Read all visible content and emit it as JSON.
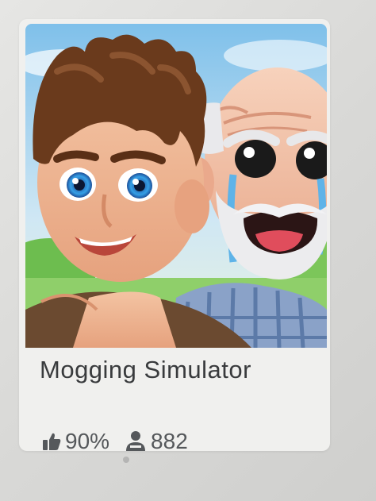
{
  "game_card": {
    "title": "Mogging Simulator",
    "thumbnail_icon": "game-thumbnail-image",
    "stats": {
      "like_icon": "thumbs-up-icon",
      "like_ratio": "90%",
      "players_icon": "players-icon",
      "player_count": "882"
    }
  },
  "colors": {
    "card_background": "#f0f0ee",
    "title_text": "#393b3d",
    "stats_text": "#55585b",
    "page_background": "#d9d9d7"
  }
}
